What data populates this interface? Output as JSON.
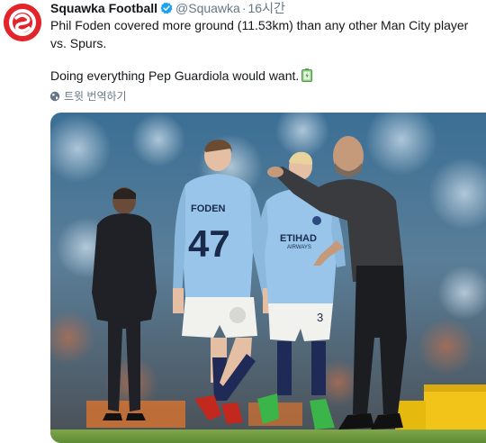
{
  "tweet": {
    "display_name": "Squawka Football",
    "handle": "@Squawka",
    "separator": "·",
    "time": "16시간",
    "text_line1": "Phil Foden covered more ground (11.53km) than any other Man City player vs. Spurs.",
    "text_line2": "Doing everything Pep Guardiola would want.",
    "translate_label": "트윗 번역하기",
    "verified_icon": "verified-badge-icon",
    "emoji_icon": "battery-emoji-icon",
    "globe_icon": "globe-icon"
  },
  "photo": {
    "player_name": "FODEN",
    "player_number": "47",
    "sponsor": "ETIHAD",
    "sponsor_sub": "AIRWAYS",
    "shorts_number": "3"
  },
  "colors": {
    "brand_red": "#e3242b",
    "verified_blue": "#1da1f2",
    "text": "#14171a",
    "muted": "#657786",
    "city_blue": "#98c5e9"
  }
}
